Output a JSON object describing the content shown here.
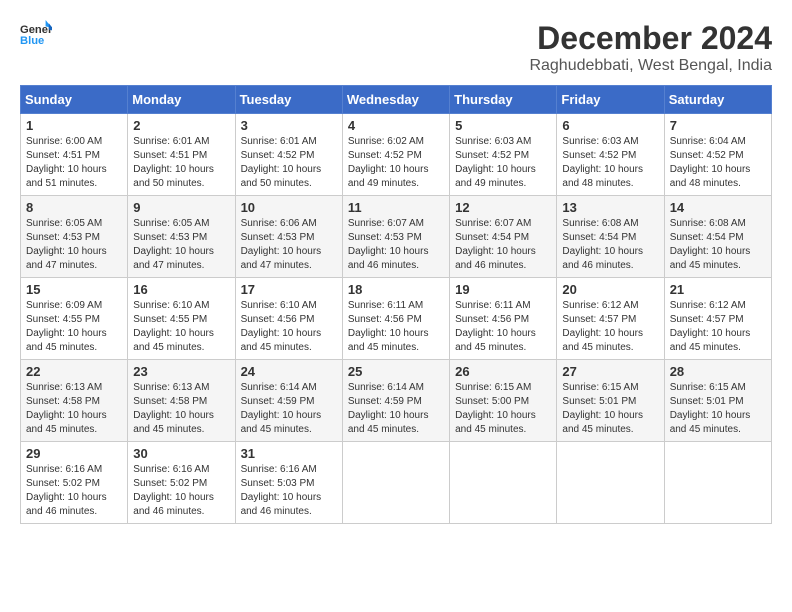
{
  "header": {
    "logo_line1": "General",
    "logo_line2": "Blue",
    "title": "December 2024",
    "subtitle": "Raghudebbati, West Bengal, India"
  },
  "weekdays": [
    "Sunday",
    "Monday",
    "Tuesday",
    "Wednesday",
    "Thursday",
    "Friday",
    "Saturday"
  ],
  "weeks": [
    [
      {
        "day": "1",
        "sunrise": "6:00 AM",
        "sunset": "4:51 PM",
        "daylight": "10 hours and 51 minutes."
      },
      {
        "day": "2",
        "sunrise": "6:01 AM",
        "sunset": "4:51 PM",
        "daylight": "10 hours and 50 minutes."
      },
      {
        "day": "3",
        "sunrise": "6:01 AM",
        "sunset": "4:52 PM",
        "daylight": "10 hours and 50 minutes."
      },
      {
        "day": "4",
        "sunrise": "6:02 AM",
        "sunset": "4:52 PM",
        "daylight": "10 hours and 49 minutes."
      },
      {
        "day": "5",
        "sunrise": "6:03 AM",
        "sunset": "4:52 PM",
        "daylight": "10 hours and 49 minutes."
      },
      {
        "day": "6",
        "sunrise": "6:03 AM",
        "sunset": "4:52 PM",
        "daylight": "10 hours and 48 minutes."
      },
      {
        "day": "7",
        "sunrise": "6:04 AM",
        "sunset": "4:52 PM",
        "daylight": "10 hours and 48 minutes."
      }
    ],
    [
      {
        "day": "8",
        "sunrise": "6:05 AM",
        "sunset": "4:53 PM",
        "daylight": "10 hours and 47 minutes."
      },
      {
        "day": "9",
        "sunrise": "6:05 AM",
        "sunset": "4:53 PM",
        "daylight": "10 hours and 47 minutes."
      },
      {
        "day": "10",
        "sunrise": "6:06 AM",
        "sunset": "4:53 PM",
        "daylight": "10 hours and 47 minutes."
      },
      {
        "day": "11",
        "sunrise": "6:07 AM",
        "sunset": "4:53 PM",
        "daylight": "10 hours and 46 minutes."
      },
      {
        "day": "12",
        "sunrise": "6:07 AM",
        "sunset": "4:54 PM",
        "daylight": "10 hours and 46 minutes."
      },
      {
        "day": "13",
        "sunrise": "6:08 AM",
        "sunset": "4:54 PM",
        "daylight": "10 hours and 46 minutes."
      },
      {
        "day": "14",
        "sunrise": "6:08 AM",
        "sunset": "4:54 PM",
        "daylight": "10 hours and 45 minutes."
      }
    ],
    [
      {
        "day": "15",
        "sunrise": "6:09 AM",
        "sunset": "4:55 PM",
        "daylight": "10 hours and 45 minutes."
      },
      {
        "day": "16",
        "sunrise": "6:10 AM",
        "sunset": "4:55 PM",
        "daylight": "10 hours and 45 minutes."
      },
      {
        "day": "17",
        "sunrise": "6:10 AM",
        "sunset": "4:56 PM",
        "daylight": "10 hours and 45 minutes."
      },
      {
        "day": "18",
        "sunrise": "6:11 AM",
        "sunset": "4:56 PM",
        "daylight": "10 hours and 45 minutes."
      },
      {
        "day": "19",
        "sunrise": "6:11 AM",
        "sunset": "4:56 PM",
        "daylight": "10 hours and 45 minutes."
      },
      {
        "day": "20",
        "sunrise": "6:12 AM",
        "sunset": "4:57 PM",
        "daylight": "10 hours and 45 minutes."
      },
      {
        "day": "21",
        "sunrise": "6:12 AM",
        "sunset": "4:57 PM",
        "daylight": "10 hours and 45 minutes."
      }
    ],
    [
      {
        "day": "22",
        "sunrise": "6:13 AM",
        "sunset": "4:58 PM",
        "daylight": "10 hours and 45 minutes."
      },
      {
        "day": "23",
        "sunrise": "6:13 AM",
        "sunset": "4:58 PM",
        "daylight": "10 hours and 45 minutes."
      },
      {
        "day": "24",
        "sunrise": "6:14 AM",
        "sunset": "4:59 PM",
        "daylight": "10 hours and 45 minutes."
      },
      {
        "day": "25",
        "sunrise": "6:14 AM",
        "sunset": "4:59 PM",
        "daylight": "10 hours and 45 minutes."
      },
      {
        "day": "26",
        "sunrise": "6:15 AM",
        "sunset": "5:00 PM",
        "daylight": "10 hours and 45 minutes."
      },
      {
        "day": "27",
        "sunrise": "6:15 AM",
        "sunset": "5:01 PM",
        "daylight": "10 hours and 45 minutes."
      },
      {
        "day": "28",
        "sunrise": "6:15 AM",
        "sunset": "5:01 PM",
        "daylight": "10 hours and 45 minutes."
      }
    ],
    [
      {
        "day": "29",
        "sunrise": "6:16 AM",
        "sunset": "5:02 PM",
        "daylight": "10 hours and 46 minutes."
      },
      {
        "day": "30",
        "sunrise": "6:16 AM",
        "sunset": "5:02 PM",
        "daylight": "10 hours and 46 minutes."
      },
      {
        "day": "31",
        "sunrise": "6:16 AM",
        "sunset": "5:03 PM",
        "daylight": "10 hours and 46 minutes."
      },
      null,
      null,
      null,
      null
    ]
  ]
}
